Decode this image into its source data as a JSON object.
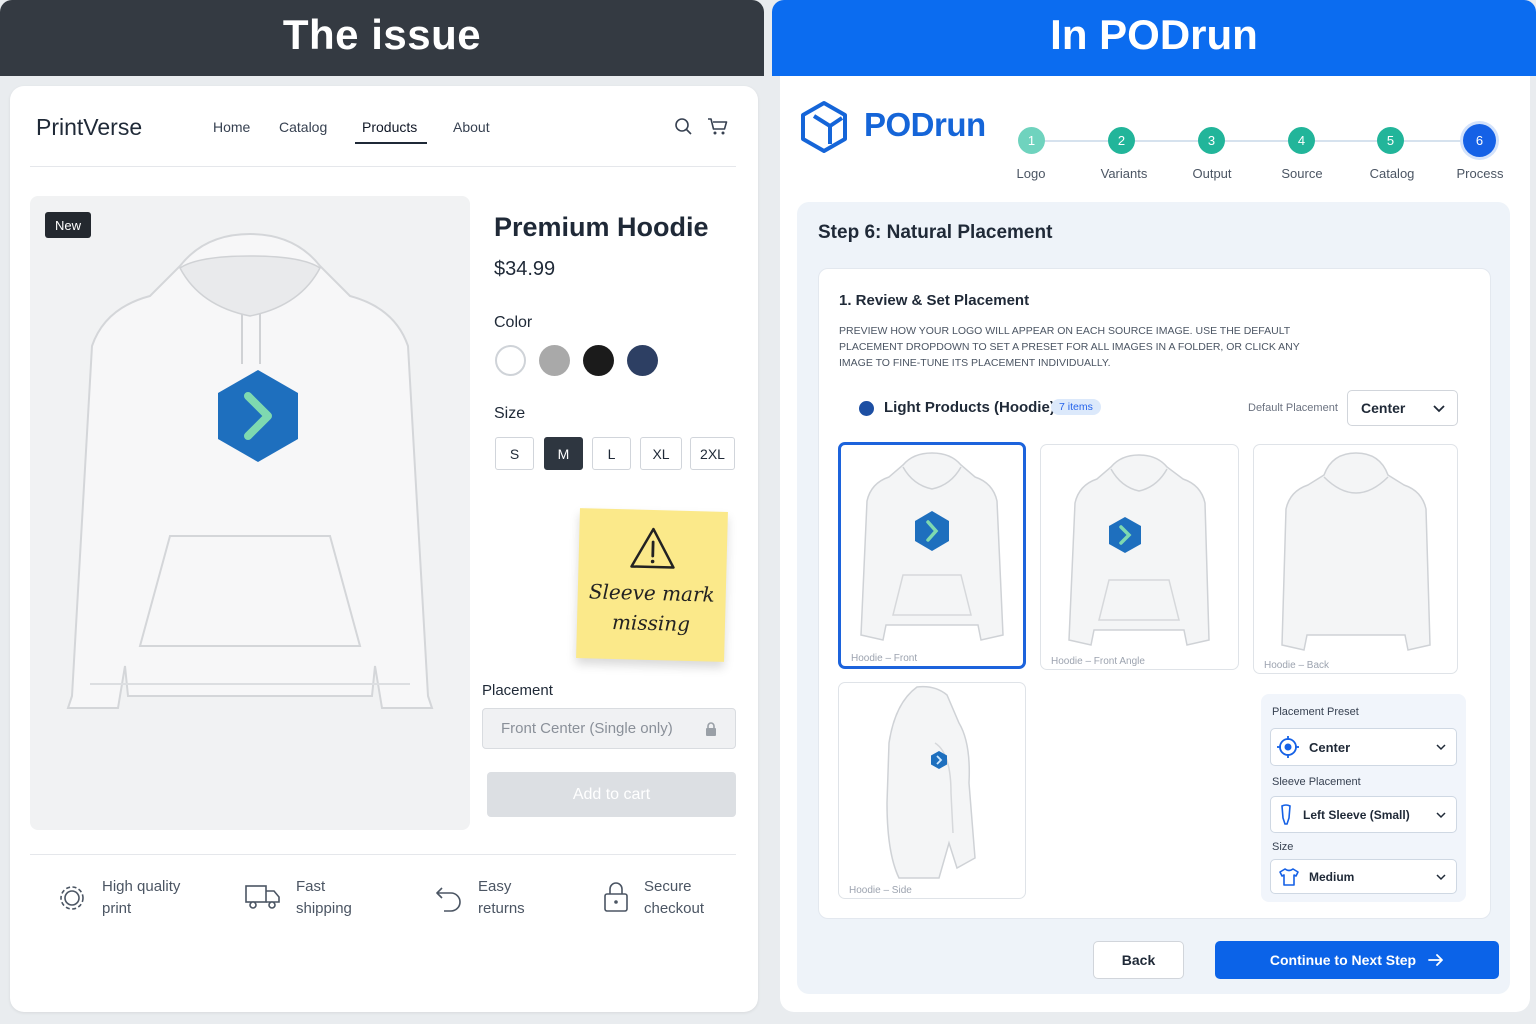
{
  "left_panel": {
    "header": "The issue",
    "brand": "PrintVerse",
    "nav": [
      "Home",
      "Catalog",
      "Products",
      "About"
    ],
    "active_nav": "Products",
    "badge": "New",
    "product": {
      "title": "Premium Hoodie",
      "price": "$34.99",
      "color_label": "Color",
      "colors": [
        "#ffffff",
        "#a9a9a9",
        "#1b1b1b",
        "#2d3f63"
      ],
      "size_label": "Size",
      "sizes": [
        "S",
        "M",
        "L",
        "XL",
        "2XL"
      ],
      "selected_size": "M",
      "placement_label": "Placement",
      "placement_value": "Front Center (Single only)",
      "add_to_cart": "Add to cart"
    },
    "sticky_note": {
      "line1": "Sleeve mark",
      "line2": "missing"
    },
    "features": [
      {
        "icon": "gear-icon",
        "line1": "High quality",
        "line2": "print"
      },
      {
        "icon": "truck-icon",
        "line1": "Fast",
        "line2": "shipping"
      },
      {
        "icon": "return-icon",
        "line1": "Easy",
        "line2": "returns"
      },
      {
        "icon": "lock-icon",
        "line1": "Secure",
        "line2": "checkout"
      }
    ]
  },
  "right_panel": {
    "header": "In PODrun",
    "brand": "PODrun",
    "steps": [
      {
        "num": "1",
        "label": "Logo",
        "color": "#6fd3be"
      },
      {
        "num": "2",
        "label": "Variants",
        "color": "#22b59a"
      },
      {
        "num": "3",
        "label": "Output",
        "color": "#22b59a"
      },
      {
        "num": "4",
        "label": "Source",
        "color": "#22b59a"
      },
      {
        "num": "5",
        "label": "Catalog",
        "color": "#22b59a"
      },
      {
        "num": "6",
        "label": "Process",
        "color": "#1561e6"
      }
    ],
    "step_heading": "Step 6: Natural Placement",
    "review": {
      "title": "1. Review & Set Placement",
      "description": "Preview how your logo will appear on each source image. Use the default placement dropdown to set a preset for all images in a folder, or click any image to fine-tune its placement individually.",
      "folder_name": "Light Products (Hoodie)",
      "items_badge": "7 items",
      "default_placement_label": "Default Placement",
      "default_placement_value": "Center"
    },
    "thumbnails": [
      {
        "caption": "Hoodie – Front"
      },
      {
        "caption": "Hoodie – Front Angle"
      },
      {
        "caption": "Hoodie – Back"
      },
      {
        "caption": "Hoodie – Side"
      }
    ],
    "placement_panel": {
      "preset_label": "Placement Preset",
      "preset_value": "Center",
      "sleeve_label": "Sleeve Placement",
      "sleeve_value": "Left Sleeve (Small)",
      "size_label": "Size",
      "size_value": "Medium"
    },
    "buttons": {
      "back": "Back",
      "next": "Continue to Next Step"
    },
    "accent": "#0b63e8"
  }
}
